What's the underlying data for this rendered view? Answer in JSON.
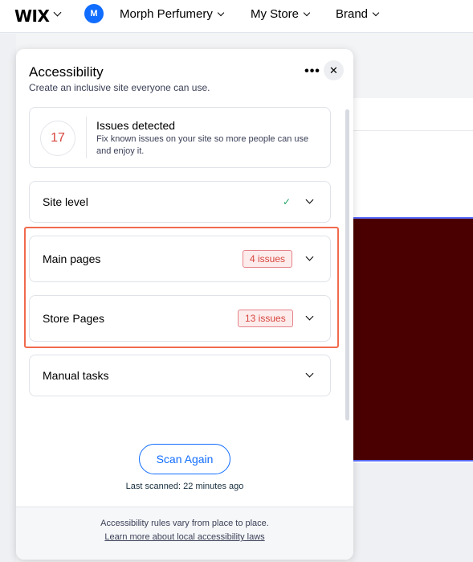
{
  "topbar": {
    "logo": "WIX",
    "avatar_initial": "M",
    "site_name": "Morph Perfumery",
    "menu_store": "My Store",
    "menu_brand": "Brand"
  },
  "panel": {
    "title": "Accessibility",
    "subtitle": "Create an inclusive site everyone can use.",
    "more_label": "•••",
    "close_label": "✕",
    "issues": {
      "count": "17",
      "heading": "Issues detected",
      "description": "Fix known issues on your site so more people can use and enjoy it."
    },
    "sections": [
      {
        "label": "Site level",
        "status_icon": "✓"
      },
      {
        "label": "Main pages",
        "badge": "4 issues"
      },
      {
        "label": "Store Pages",
        "badge": "13 issues"
      },
      {
        "label": "Manual tasks"
      }
    ],
    "scan_button": "Scan Again",
    "last_scanned": "Last scanned: 22 minutes ago",
    "footer_note": "Accessibility rules vary from place to place.",
    "footer_link": "Learn more about local accessibility laws"
  },
  "colors": {
    "accent": "#116dff",
    "issue_red": "#d6453d",
    "highlight": "#f16a4e",
    "success": "#21a366",
    "canvas": "#4a0000"
  }
}
